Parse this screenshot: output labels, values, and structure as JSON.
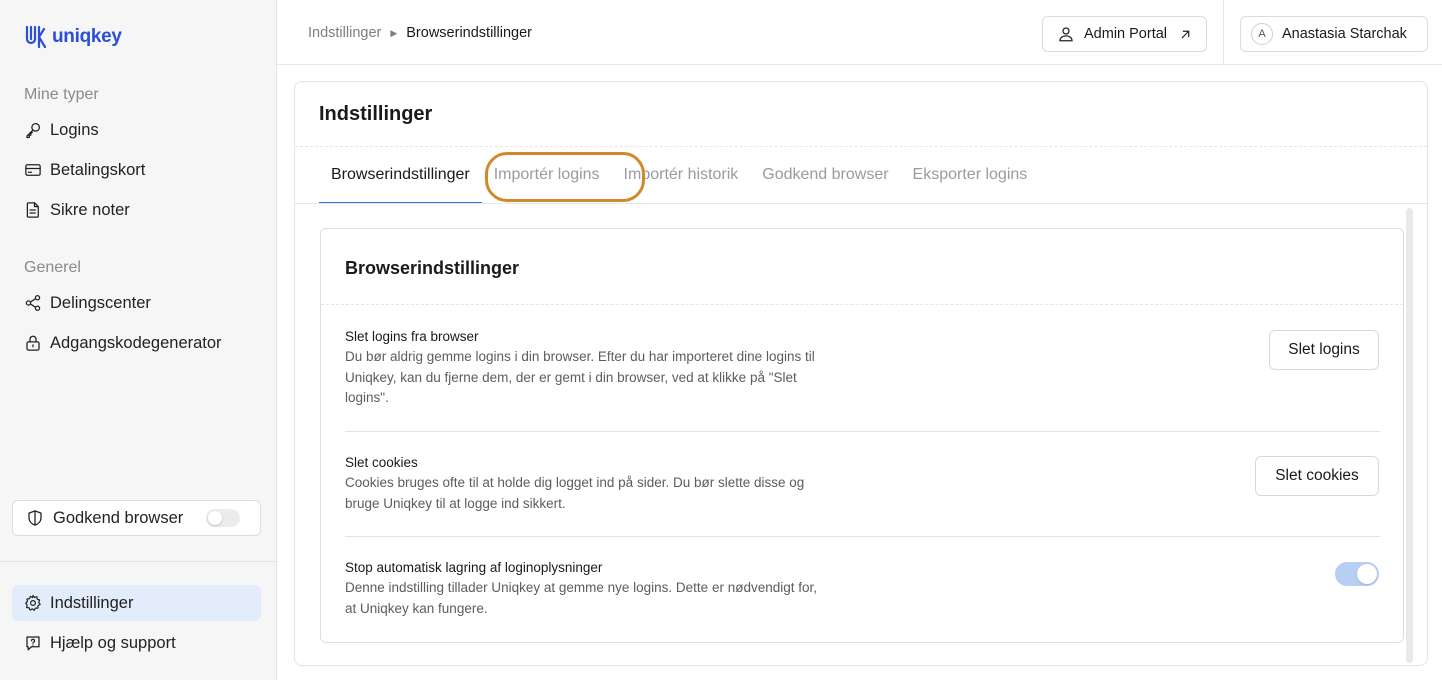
{
  "app": {
    "logo_text": "uniqkey",
    "accent_color": "#2b4fd6"
  },
  "sidebar": {
    "section_mine": "Mine typer",
    "section_general": "Generel",
    "items": [
      {
        "label": "Logins",
        "icon": "key-icon"
      },
      {
        "label": "Betalingskort",
        "icon": "credit-card-icon"
      },
      {
        "label": "Sikre noter",
        "icon": "note-icon"
      },
      {
        "label": "Delingscenter",
        "icon": "share-icon"
      },
      {
        "label": "Adgangskodegenerator",
        "icon": "lock-icon"
      }
    ],
    "godkend_browser": {
      "label": "Godkend browser",
      "icon": "shield-icon",
      "toggle_on": false
    },
    "bottom_items": [
      {
        "label": "Indstillinger",
        "icon": "gear-icon",
        "active": true
      },
      {
        "label": "Hjælp og support",
        "icon": "help-icon"
      }
    ]
  },
  "header": {
    "breadcrumb": [
      "Indstillinger",
      "Browserindstillinger"
    ],
    "admin_portal_label": "Admin Portal",
    "user_initial": "A",
    "user_name": "Anastasia Starchak"
  },
  "main": {
    "title": "Indstillinger",
    "tabs": [
      {
        "label": "Browserindstillinger",
        "active": true
      },
      {
        "label": "Importér logins",
        "highlighted": true
      },
      {
        "label": "Importér historik"
      },
      {
        "label": "Godkend browser"
      },
      {
        "label": "Eksporter logins"
      }
    ],
    "highlight_color": "#d08a2b",
    "section_title": "Browserindstillinger",
    "settings": [
      {
        "title": "Slet logins fra browser",
        "description": "Du bør aldrig gemme logins i din browser. Efter du har importeret dine logins til Uniqkey, kan du fjerne dem, der er gemt i din browser, ved at klikke på \"Slet logins\".",
        "button_label": "Slet logins"
      },
      {
        "title": "Slet cookies",
        "description": "Cookies bruges ofte til at holde dig logget ind på sider. Du bør slette disse og bruge Uniqkey til at logge ind sikkert.",
        "button_label": "Slet cookies"
      },
      {
        "title": "Stop automatisk lagring af loginoplysninger",
        "description": "Denne indstilling tillader Uniqkey at gemme nye logins. Dette er nødvendigt for, at Uniqkey kan fungere.",
        "toggle_on": true
      }
    ]
  }
}
